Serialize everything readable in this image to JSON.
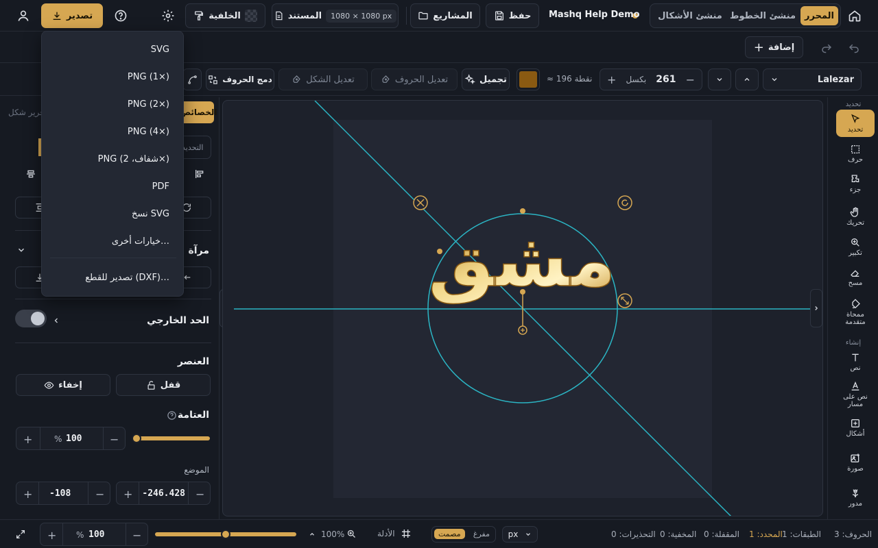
{
  "topbar": {
    "tabs": [
      {
        "label": "المحرر",
        "active": true
      },
      {
        "label": "منشئ الخطوط",
        "active": false
      },
      {
        "label": "منشئ الأشكال",
        "active": false
      }
    ],
    "project_name": "Mashq Help Demo",
    "save_label": "حفظ",
    "projects_label": "المشاريع",
    "document_label": "المستند",
    "document_size": "1080 × 1080 px",
    "background_label": "الخلفية",
    "export_label": "تصدير"
  },
  "export_menu": {
    "items": [
      "SVG",
      "PNG (1×)",
      "PNG (2×)",
      "PNG (4×)",
      "PNG (شفاف، 2×)",
      "PDF",
      "نسخ SVG",
      "خيارات أخرى…",
      "تصدير للقطع (DXF)…"
    ]
  },
  "row2": {
    "add_label": "إضافة"
  },
  "row3": {
    "font_name": "Lalezar",
    "size_value": "261",
    "size_unit": "بكسل",
    "size_points": "≈ 196 نقطة",
    "color": "#8a5a12",
    "beautify_label": "تجميل",
    "edit_letters_label": "تعديل الحروف",
    "edit_shape_label": "تعديل الشكل",
    "merge_letters_label": "دمج الحروف"
  },
  "left_panel": {
    "edit_shape_hint": "تحرير شكل",
    "properties_tab": "الخصائص",
    "selection_label": "التحديد",
    "mirror_title": "مرآة",
    "outline_title": "الحد الخارجي",
    "element_title": "العنصر",
    "lock_label": "قفل",
    "hide_label": "إخفاء",
    "opacity_title": "العتامة",
    "opacity_value": "100",
    "opacity_unit": "%",
    "position_title": "الموضع",
    "position_x": "-246.428",
    "position_y": "-108"
  },
  "right_tools": {
    "section_select": "تحديد",
    "section_create": "إنشاء",
    "items": [
      {
        "label": "تحديد",
        "icon": "cursor-icon",
        "active": true
      },
      {
        "label": "حرف",
        "icon": "letter-select-icon",
        "active": false
      },
      {
        "label": "جزء",
        "icon": "part-icon",
        "active": false
      },
      {
        "label": "تحريك",
        "icon": "hand-icon",
        "active": false
      },
      {
        "label": "تكبير",
        "icon": "zoom-icon",
        "active": false
      },
      {
        "label": "مسح",
        "icon": "eraser-icon",
        "active": false
      },
      {
        "label": "ممحاة متقدمة",
        "icon": "advanced-eraser-icon",
        "active": false
      },
      {
        "label": "نص",
        "icon": "text-icon",
        "active": false
      },
      {
        "label": "نص على مسار",
        "icon": "text-path-icon",
        "active": false
      },
      {
        "label": "أشكال",
        "icon": "shapes-icon",
        "active": false
      },
      {
        "label": "صورة",
        "icon": "image-icon",
        "active": false
      },
      {
        "label": "مدور",
        "icon": "flower-icon",
        "active": false
      }
    ]
  },
  "canvas": {
    "artwork_text": "مشق"
  },
  "statusbar": {
    "letters": "الحروف: 3",
    "layers": "الطبقات: 1",
    "selected": "المحدد: 1",
    "locked": "المقفلة: 0",
    "hidden": "المخفية: 0",
    "warnings": "التحذيرات: 0",
    "unit": "px",
    "hollow": "مفرغ",
    "solid": "مصمت",
    "guides": "الأدلة",
    "zoom_readout": "100%",
    "zoom_value": "100",
    "zoom_unit": "%",
    "zoom_level": 0.5
  },
  "colors": {
    "accent": "#d6a752",
    "guide": "#2bb5c4"
  }
}
